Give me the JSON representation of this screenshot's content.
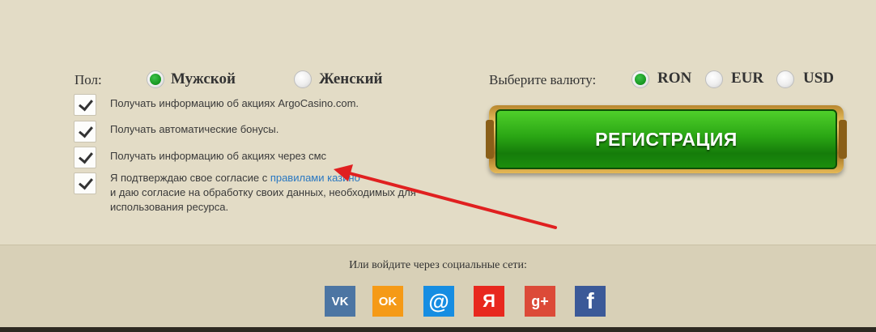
{
  "gender": {
    "label": "Пол:",
    "options": [
      {
        "label": "Мужской",
        "selected": true
      },
      {
        "label": "Женский",
        "selected": false
      }
    ]
  },
  "checkboxes": [
    {
      "text": "Получать информацию об акциях ArgoCasino.com.",
      "checked": true
    },
    {
      "text": "Получать автоматические бонусы.",
      "checked": true
    },
    {
      "text": "Получать информацию об акциях через смс",
      "checked": true
    },
    {
      "text_before": "Я подтверждаю свое согласие с ",
      "link": "правилами казино",
      "line2": "и даю согласие на обработку своих данных, необходимых для",
      "line3": "использования ресурса.",
      "checked": true
    }
  ],
  "currency": {
    "label": "Выберите валюту:",
    "options": [
      {
        "label": "RON",
        "selected": true
      },
      {
        "label": "EUR",
        "selected": false
      },
      {
        "label": "USD",
        "selected": false
      }
    ]
  },
  "register_button": "РЕГИСТРАЦИЯ",
  "social": {
    "title": "Или войдите через социальные сети:",
    "networks": [
      {
        "icon": "vk-icon",
        "glyph": "VK",
        "color": "#4c75a3"
      },
      {
        "icon": "odnoklassniki-icon",
        "glyph": "OK",
        "color": "#f59a17"
      },
      {
        "icon": "mailru-icon",
        "glyph": "@",
        "color": "#168de2"
      },
      {
        "icon": "yandex-icon",
        "glyph": "Я",
        "color": "#e8281e"
      },
      {
        "icon": "google-plus-icon",
        "glyph": "g+",
        "color": "#dc4a38"
      },
      {
        "icon": "facebook-icon",
        "glyph": "f",
        "color": "#3b5998"
      }
    ]
  },
  "colors": {
    "background": "#e3dcc6",
    "footer": "#d8d0b7",
    "accent_green": "#2aa614",
    "annotation_arrow": "#e02020",
    "link": "#2a78c2"
  }
}
